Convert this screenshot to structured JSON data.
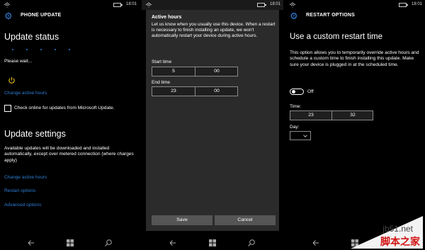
{
  "panel1": {
    "status_time": "18:01",
    "header_title": "PHONE UPDATE",
    "update_status_heading": "Update status",
    "please_wait": "Please wait...",
    "change_active_hours": "Change active hours",
    "check_online_label": "Check online for updates from Microsoft Update.",
    "update_settings_heading": "Update settings",
    "settings_description": "Available updates will be downloaded and installed automatically, except over metered connection (where charges apply)",
    "link_change_active_hours": "Change active hours",
    "link_restart_options": "Restart options",
    "link_advanced_options": "Advanced options"
  },
  "panel2": {
    "status_time": "18:01",
    "dialog_title": "Active hours",
    "dialog_text": "Let us know when you usually use this device. When a restart is necessary to finish installing an update, we won't automatically restart your device during active hours.",
    "start_label": "Start time",
    "start_hour": "5",
    "start_minute": "00",
    "end_label": "End time",
    "end_hour": "23",
    "end_minute": "00",
    "save_label": "Save",
    "cancel_label": "Cancel"
  },
  "panel3": {
    "status_time": "18:01",
    "header_title": "RESTART OPTIONS",
    "heading": "Use a custom restart time",
    "description": "This option allows you to temporarily override active hours and schedule a custom time to finish installing this update. Make sure your device is plugged in at the scheduled time.",
    "toggle_state": "Off",
    "time_label": "Time:",
    "time_hour": "23",
    "time_minute": "32",
    "day_label": "Day:",
    "day_value": ""
  },
  "watermark": {
    "site": "jb51.net",
    "brand": "脚本之家"
  },
  "colors": {
    "accent": "#2d7fd6",
    "background": "#000000",
    "dialog": "#2b2b2b",
    "button": "#555555"
  }
}
